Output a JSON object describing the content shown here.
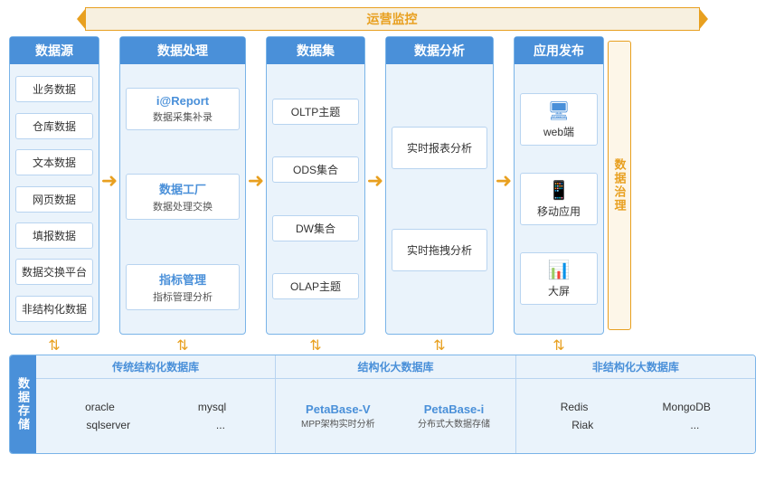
{
  "monitoring": {
    "label": "运营监控"
  },
  "governance": {
    "label": "数据治理"
  },
  "storage_label": "数据存储",
  "columns": [
    {
      "id": "datasource",
      "header": "数据源",
      "items": [
        "业务数据",
        "仓库数据",
        "文本数据",
        "网页数据",
        "填报数据",
        "数据交换平台",
        "非结构化数据"
      ]
    },
    {
      "id": "processing",
      "header": "数据处理",
      "items": [
        {
          "title": "i@Report",
          "subtitle": "数据采集补录"
        },
        {
          "title": "数据工厂",
          "subtitle": "数据处理交换"
        },
        {
          "title": "指标管理",
          "subtitle": "指标管理分析"
        }
      ]
    },
    {
      "id": "collection",
      "header": "数据集",
      "items": [
        "OLTP主题",
        "ODS集合",
        "DW集合",
        "OLAP主题"
      ]
    },
    {
      "id": "analysis",
      "header": "数据分析",
      "items": [
        "实时报表分析",
        "实时拖拽分析"
      ]
    },
    {
      "id": "apprelease",
      "header": "应用发布",
      "items": [
        {
          "icon": "🖥",
          "label": "web端"
        },
        {
          "icon": "📱",
          "label": "移动应用"
        },
        {
          "icon": "📊",
          "label": "大屏"
        }
      ]
    }
  ],
  "bottom": {
    "sections": [
      {
        "label": "传统结构化数据库",
        "rows": [
          [
            "oracle",
            "mysql"
          ],
          [
            "sqlserver",
            "..."
          ]
        ]
      },
      {
        "label": "结构化大数据库",
        "special": [
          {
            "title": "PetaBase-V",
            "sub": "MPP架构实时分析"
          },
          {
            "title": "PetaBase-i",
            "sub": "分布式大数据存储"
          }
        ]
      },
      {
        "label": "非结构化大数据库",
        "rows": [
          [
            "Redis",
            "MongoDB"
          ],
          [
            "Riak",
            "..."
          ]
        ]
      }
    ]
  }
}
